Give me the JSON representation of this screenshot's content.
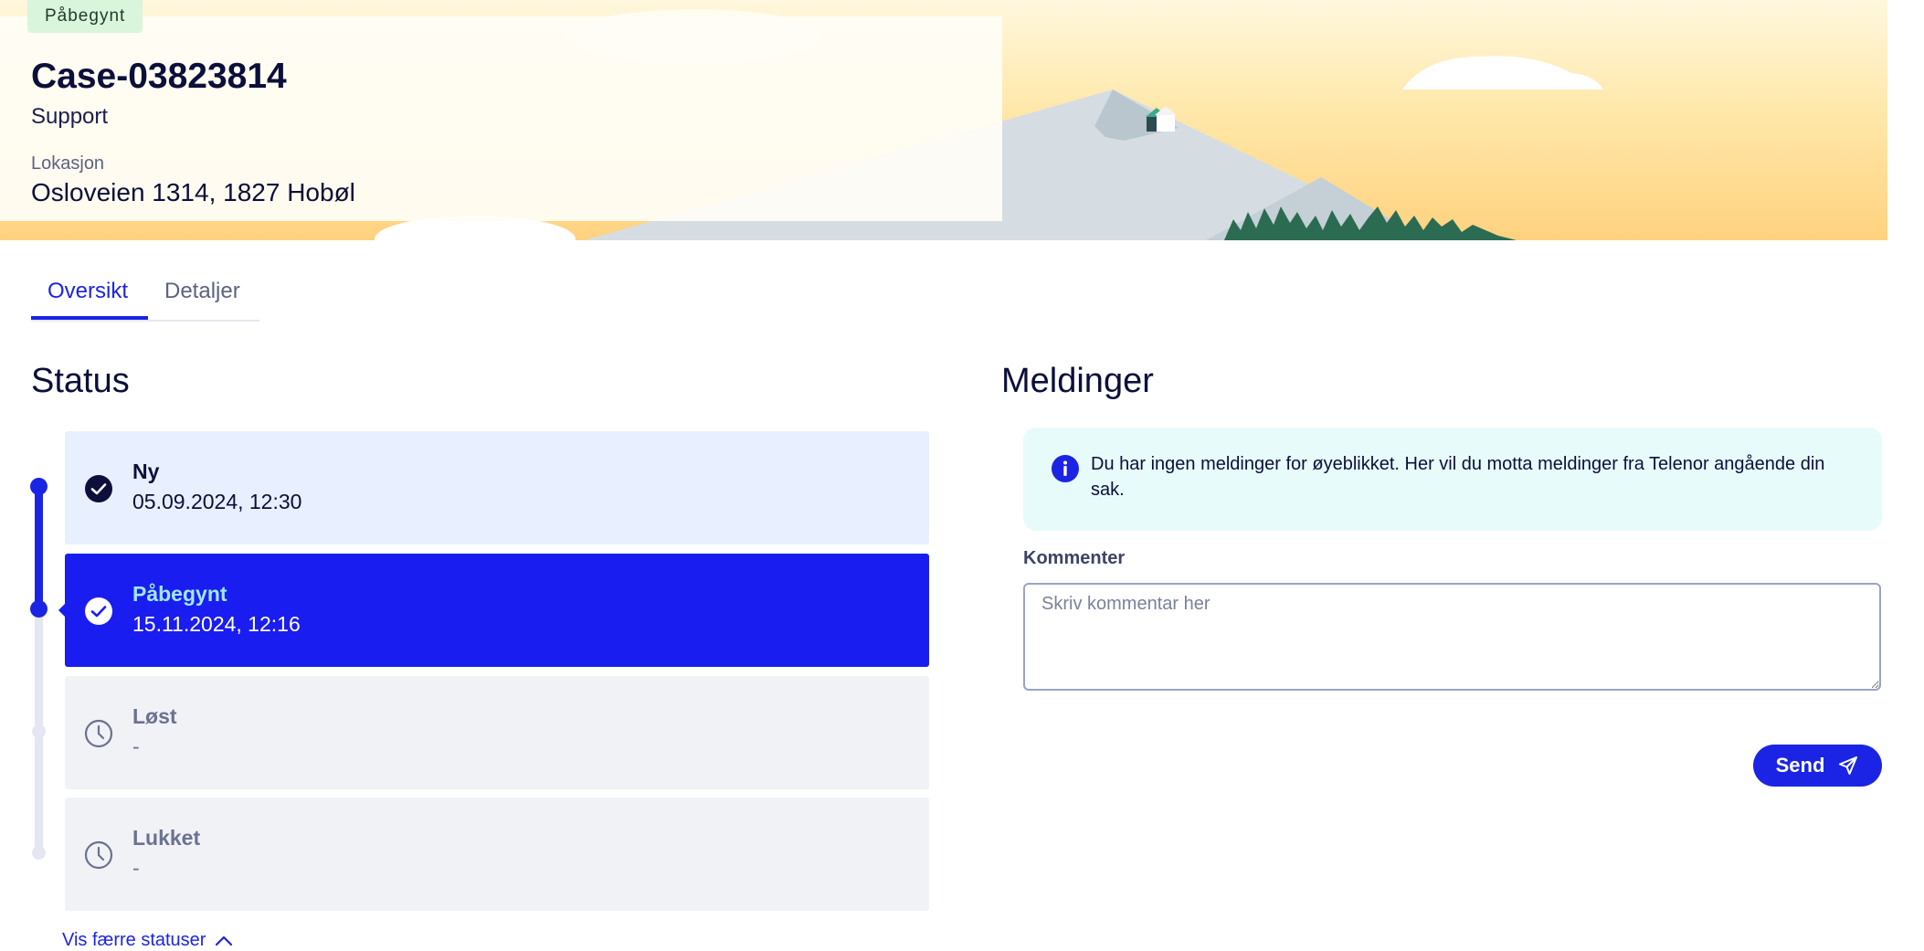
{
  "header": {
    "badge": "Påbegynt",
    "case_id": "Case-03823814",
    "case_type": "Support",
    "location_label": "Lokasjon",
    "location_value": "Osloveien 1314, 1827 Hobøl"
  },
  "tabs": [
    {
      "label": "Oversikt",
      "active": true
    },
    {
      "label": "Detaljer",
      "active": false
    }
  ],
  "status": {
    "heading": "Status",
    "steps": [
      {
        "name": "Ny",
        "time": "05.09.2024, 12:30",
        "state": "done"
      },
      {
        "name": "Påbegynt",
        "time": "15.11.2024, 12:16",
        "state": "current"
      },
      {
        "name": "Løst",
        "time": "-",
        "state": "pending"
      },
      {
        "name": "Lukket",
        "time": "-",
        "state": "pending"
      }
    ],
    "toggle_label": "Vis færre statuser"
  },
  "messages": {
    "heading": "Meldinger",
    "info_text": "Du har ingen meldinger for øyeblikket. Her vil du motta meldinger fra Telenor angående din sak.",
    "comment_label": "Kommenter",
    "comment_placeholder": "Skriv kommentar her",
    "send_label": "Send"
  },
  "colors": {
    "accent": "#1b24e5",
    "badge_bg": "#d9f5dc",
    "info_bg": "#e8fbfb"
  }
}
